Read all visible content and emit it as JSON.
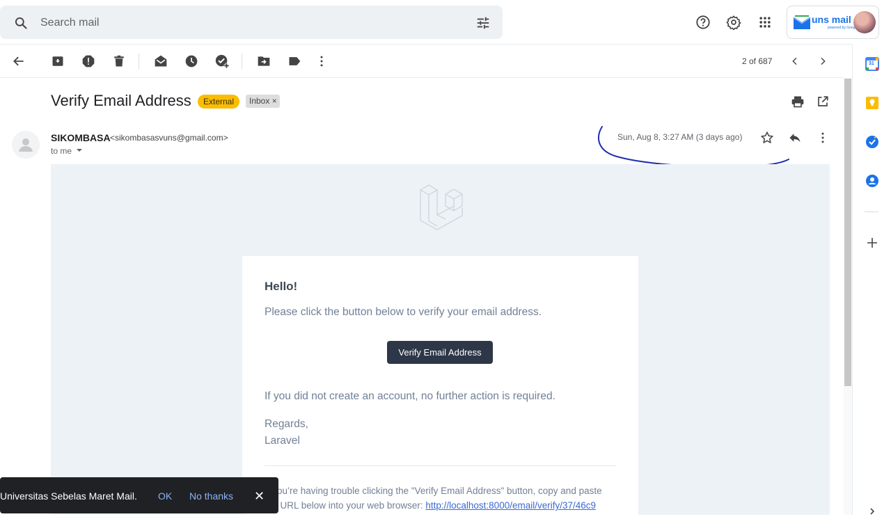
{
  "search": {
    "placeholder": "Search mail"
  },
  "header": {
    "icons": [
      "search-icon",
      "tune-icon",
      "help-icon",
      "settings-icon",
      "apps-icon"
    ],
    "account_brand": "uns mail",
    "account_brand_sub": "powered by Google"
  },
  "toolbar": {
    "icons": [
      "back-arrow-icon",
      "archive-icon",
      "report-spam-icon",
      "delete-icon",
      "mark-unread-icon",
      "snooze-icon",
      "add-task-icon",
      "move-to-icon",
      "label-icon",
      "more-vert-icon"
    ],
    "pager": "2 of 687"
  },
  "message": {
    "subject": "Verify Email Address",
    "label_external": "External",
    "label_inbox": "Inbox",
    "label_remove": "×",
    "sender_name": "SIKOMBASA",
    "sender_email": "<sikombasasvuns@gmail.com>",
    "to": "to me",
    "date": "Sun, Aug 8, 3:27 AM (3 days ago)"
  },
  "email_body": {
    "greeting": "Hello!",
    "line1": "Please click the button below to verify your email address.",
    "button": "Verify Email Address",
    "line2": "If you did not create an account, no further action is required.",
    "regards": "Regards,",
    "signoff": "Laravel",
    "trouble_line1": "If you’re having trouble clicking the \"Verify Email Address\" button, copy and paste",
    "trouble_line2": "the URL below into your web browser:",
    "url": "http://localhost:8000/email/verify/37/46c9"
  },
  "side_panel": {
    "icons": [
      "calendar-icon",
      "keep-icon",
      "tasks-icon",
      "contacts-icon",
      "add-icon",
      "expand-icon"
    ],
    "calendar_day": "31"
  },
  "snackbar": {
    "text": "Universitas Sebelas Maret Mail.",
    "ok": "OK",
    "no_thanks": "No thanks",
    "close": "✕"
  },
  "colors": {
    "external_badge": "#fbbc04",
    "button_dark": "#2d3748",
    "link": "#3869d4",
    "annotation_ink": "#1d2fb0"
  }
}
